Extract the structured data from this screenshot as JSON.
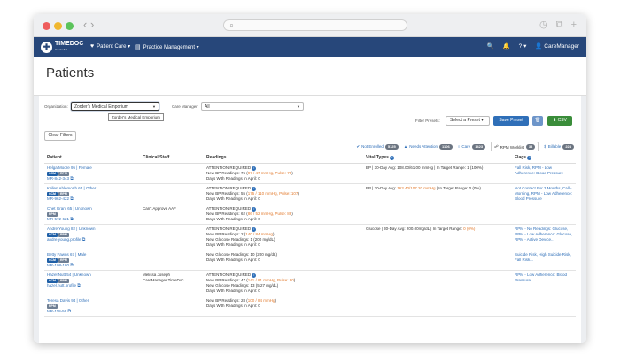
{
  "browser": {
    "nav_arrows": "‹ ›",
    "search_icon": "⌕",
    "right_icons": "◷ ⧉ +"
  },
  "app": {
    "logo_mark": "✚",
    "logo_text": "TIMEDOC",
    "logo_sub": "HEALTH",
    "nav": {
      "patient_care": "Patient Care ▾",
      "practice_management": "Practice Management ▾",
      "search": "🔍",
      "bell": "🔔",
      "help": "? ▾",
      "user": "CareManager"
    }
  },
  "page": {
    "title": "Patients"
  },
  "toolbar": {
    "organization_label": "Organization:",
    "organization_value": "Zorder's Medical Emporium",
    "organization_tooltip": "Zorder's Medical Emporium",
    "care_manager_label": "Care Manager:",
    "care_manager_value": "All",
    "filter_presets_label": "Filter Presets:",
    "select_preset": "Select a Preset ▾",
    "save_preset": "Save Preset",
    "trash": "🗑",
    "csv": "⬇ CSV",
    "clear_filters": "Clear Filters"
  },
  "filters": [
    {
      "label": "Not Enrolled",
      "count": "5125",
      "icon": "✔"
    },
    {
      "label": "Needs Attention",
      "count": "1106",
      "icon": "▲"
    },
    {
      "label": "Care",
      "count": "1423",
      "icon": "○"
    },
    {
      "label": "RPM Worklist",
      "count": "38",
      "icon": "☍",
      "active": true
    },
    {
      "label": "Billable",
      "count": "224",
      "icon": "$"
    }
  ],
  "table": {
    "headers": [
      "Patient",
      "Clinical Staff",
      "Readings",
      "Vital Types",
      "Flags"
    ],
    "rows": [
      {
        "name": "Helga Moore 95 | Female",
        "tags": [
          "CCM",
          "RPM"
        ],
        "mrn": "MR-842-343",
        "staff": "",
        "attention": "ATTENTION REQUIRED",
        "readings_prefix": "New BP Readings: 76 (",
        "readings_warn": "97 / 47 mmHg, Pulse: 79",
        "readings_suffix": ")",
        "days": "Days With Readings In April: 0",
        "vital_prefix": "BP | 30-Day Avg: 108.00/61.00 mmHg | In Target Range: 1 (100%)",
        "vital_warn": "",
        "vital_suffix": "",
        "flags": "Fall Risk, RPM - Low Adherence: Blood Pressure"
      },
      {
        "name": "Kellen Ahlemorth 64 | Other",
        "tags": [
          "CCM",
          "RPM"
        ],
        "mrn": "MR-962-422",
        "staff": "",
        "attention": "ATTENTION REQUIRED",
        "readings_prefix": "New BP Readings: 55 (",
        "readings_warn": "175 / 110 mmHg, Pulse: 107",
        "readings_suffix": ")",
        "days": "Days With Readings In April: 0",
        "vital_prefix": "BP | 30-Day Avg: ",
        "vital_warn": "163.40/107.20 mmHg",
        "vital_suffix": " | In Target Range: 0 (0%)",
        "flags": "Not Contact For 3 Months, Call - Morning, RPM - Low Adherence: Blood Pressure"
      },
      {
        "name": "Chet Grant 65 | Unknown",
        "tags": [
          "RPM"
        ],
        "mrn": "MR-572-621",
        "staff": "Can't Approve AAF",
        "attention": "ATTENTION REQUIRED",
        "readings_prefix": "New BP Readings: 62 (",
        "readings_warn": "86 / 52 mmHg, Pulse: 88",
        "readings_suffix": ")",
        "days": "Days With Readings In April: 0",
        "vital_prefix": "",
        "vital_warn": "",
        "vital_suffix": "",
        "flags": ""
      },
      {
        "name": "Andre Young 82 | Unknown",
        "tags": [
          "CCM",
          "RPM"
        ],
        "mrn": "andre.young.profile",
        "staff": "",
        "attention": "ATTENTION REQUIRED",
        "readings_prefix": "New BP Readings: 2 (",
        "readings_warn": "140 / 84 mmHg",
        "readings_suffix": ")",
        "readings2": "New Glucose Readings: 1 (200 mg/dL)",
        "days": "Days With Readings In April: 0",
        "vital_prefix": "Glucose | 30-Day Avg: 200.00mg/dL | In Target Range: ",
        "vital_warn": "0 (0%)",
        "vital_suffix": "",
        "flags": "RPM - No Readings: Glucose, RPM - Low Adherence: Glucose, RPM - Active Device..."
      },
      {
        "name": "Betty Fawns 67 | Male",
        "tags": [
          "CCM",
          "RPM"
        ],
        "mrn": "MR-108-180",
        "staff": "",
        "attention": "",
        "readings_prefix": "",
        "readings_warn": "",
        "readings_suffix": "",
        "readings2": "New Glucose Readings: 10 (200 mg/dL)",
        "days": "Days With Readings In April: 0",
        "vital_prefix": "",
        "vital_warn": "",
        "vital_suffix": "",
        "flags": "Suicide Risk, High Suicide Risk, Fall Risk..."
      },
      {
        "name": "Hazel Nutt 54 | Unknown",
        "tags": [
          "CCM",
          "RPM"
        ],
        "mrn": "hazel.nutt.profile",
        "staff": "Melissa Joseph\nCareManager TimeDoc",
        "attention": "ATTENTION REQUIRED",
        "readings_prefix": "New BP Readings: 47 (",
        "readings_warn": "141 / 81 mmHg, Pulse: 90",
        "readings_suffix": ")",
        "readings2": "New Glucose Readings: 13 (5.27 mg/dL)",
        "days": "Days With Readings In April: 0",
        "vital_prefix": "",
        "vital_warn": "",
        "vital_suffix": "",
        "flags": "RPM - Low Adherence: Blood Pressure"
      },
      {
        "name": "Teresa Davis 94 | Other",
        "tags": [
          "RPM"
        ],
        "mrn": "MR-118-56",
        "staff": "",
        "attention": "",
        "readings_prefix": "New BP Readings: 28 (",
        "readings_warn": "100 / 84 mmHg",
        "readings_suffix": ")",
        "days": "Days With Readings In April: 0",
        "vital_prefix": "",
        "vital_warn": "",
        "vital_suffix": "",
        "flags": ""
      }
    ]
  }
}
